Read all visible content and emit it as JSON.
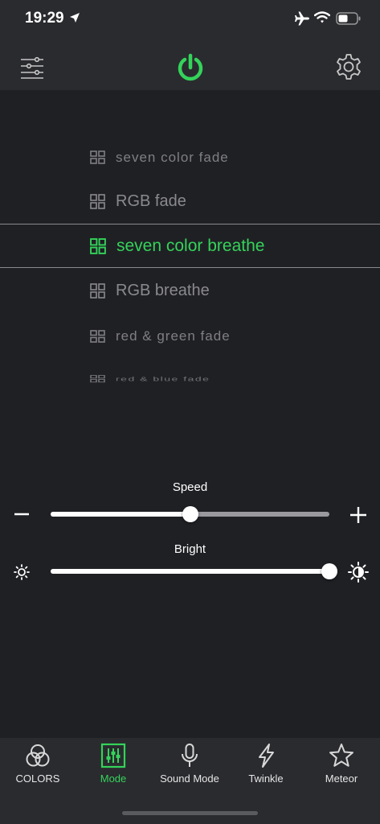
{
  "status": {
    "time": "19:29"
  },
  "modes": [
    {
      "label": "seven color fade",
      "selected": false
    },
    {
      "label": "RGB fade",
      "selected": false
    },
    {
      "label": "seven color breathe",
      "selected": true
    },
    {
      "label": "RGB breathe",
      "selected": false
    },
    {
      "label": "red & green fade",
      "selected": false
    },
    {
      "label": "red & blue fade",
      "selected": false
    }
  ],
  "speed": {
    "label": "Speed",
    "value": 0.5
  },
  "bright": {
    "label": "Bright",
    "value": 1.0
  },
  "tabs": [
    {
      "label": "COLORS",
      "icon": "colors-icon",
      "active": false
    },
    {
      "label": "Mode",
      "icon": "mode-icon",
      "active": true
    },
    {
      "label": "Sound Mode",
      "icon": "microphone-icon",
      "active": false
    },
    {
      "label": "Twinkle",
      "icon": "lightning-icon",
      "active": false
    },
    {
      "label": "Meteor",
      "icon": "star-icon",
      "active": false
    }
  ],
  "colors": {
    "accent": "#34d35a",
    "background": "#1f2024",
    "bar": "#2a2b2f",
    "inactive_text": "#8a8a8e"
  }
}
